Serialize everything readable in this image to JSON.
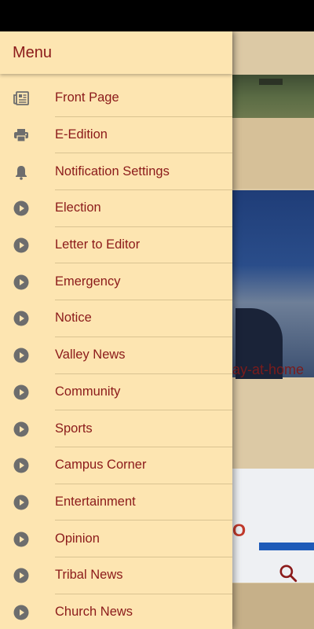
{
  "drawer": {
    "title": "Menu",
    "items": [
      {
        "label": "Front Page",
        "icon": "newspaper-icon"
      },
      {
        "label": "E-Edition",
        "icon": "printer-icon"
      },
      {
        "label": "Notification Settings",
        "icon": "bell-icon"
      },
      {
        "label": "Election",
        "icon": "play-circle-icon"
      },
      {
        "label": "Letter to Editor",
        "icon": "play-circle-icon"
      },
      {
        "label": "Emergency",
        "icon": "play-circle-icon"
      },
      {
        "label": "Notice",
        "icon": "play-circle-icon"
      },
      {
        "label": "Valley News",
        "icon": "play-circle-icon"
      },
      {
        "label": "Community",
        "icon": "play-circle-icon"
      },
      {
        "label": "Sports",
        "icon": "play-circle-icon"
      },
      {
        "label": "Campus Corner",
        "icon": "play-circle-icon"
      },
      {
        "label": "Entertainment",
        "icon": "play-circle-icon"
      },
      {
        "label": "Opinion",
        "icon": "play-circle-icon"
      },
      {
        "label": "Tribal News",
        "icon": "play-circle-icon"
      },
      {
        "label": "Church News",
        "icon": "play-circle-icon"
      }
    ]
  },
  "background": {
    "headline_fragment": "ay-at-home",
    "card_fragment": "O",
    "search_icon": "search-icon"
  },
  "colors": {
    "drawer_bg": "#fde5b1",
    "text_accent": "#8b1a1a",
    "icon_gray": "#6d6d6d"
  }
}
